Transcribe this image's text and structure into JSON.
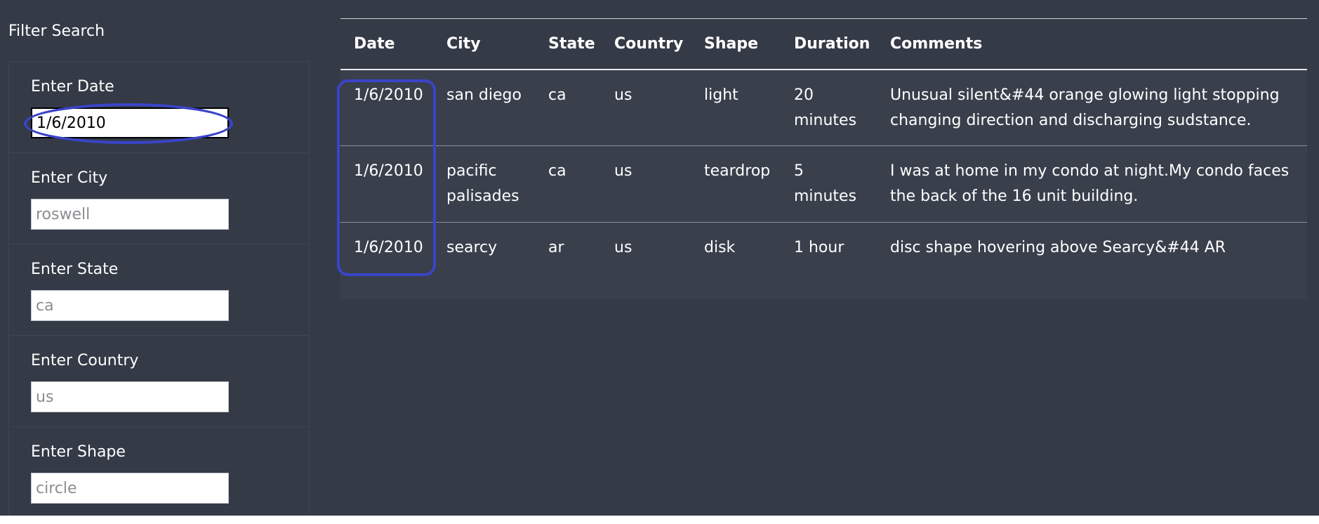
{
  "filter": {
    "title": "Filter Search",
    "fields": [
      {
        "label": "Enter Date",
        "value": "1/6/2010",
        "placeholder": ""
      },
      {
        "label": "Enter City",
        "value": "",
        "placeholder": "roswell"
      },
      {
        "label": "Enter State",
        "value": "",
        "placeholder": "ca"
      },
      {
        "label": "Enter Country",
        "value": "",
        "placeholder": "us"
      },
      {
        "label": "Enter Shape",
        "value": "",
        "placeholder": "circle"
      }
    ]
  },
  "table": {
    "columns": [
      "Date",
      "City",
      "State",
      "Country",
      "Shape",
      "Duration",
      "Comments"
    ],
    "rows": [
      [
        "1/6/2010",
        "san diego",
        "ca",
        "us",
        "light",
        "20 minutes",
        "Unusual silent&#44 orange glowing light stopping changing direction and discharging sudstance."
      ],
      [
        "1/6/2010",
        "pacific palisades",
        "ca",
        "us",
        "teardrop",
        "5 minutes",
        "I was at home in my condo at night.My condo faces the back of the 16 unit building."
      ],
      [
        "1/6/2010",
        "searcy",
        "ar",
        "us",
        "disk",
        "1 hour",
        "disc shape hovering above Searcy&#44 AR"
      ]
    ]
  },
  "colors": {
    "background": "#343a46",
    "row_background": "#393f4b",
    "highlight": "#3a44c8"
  }
}
